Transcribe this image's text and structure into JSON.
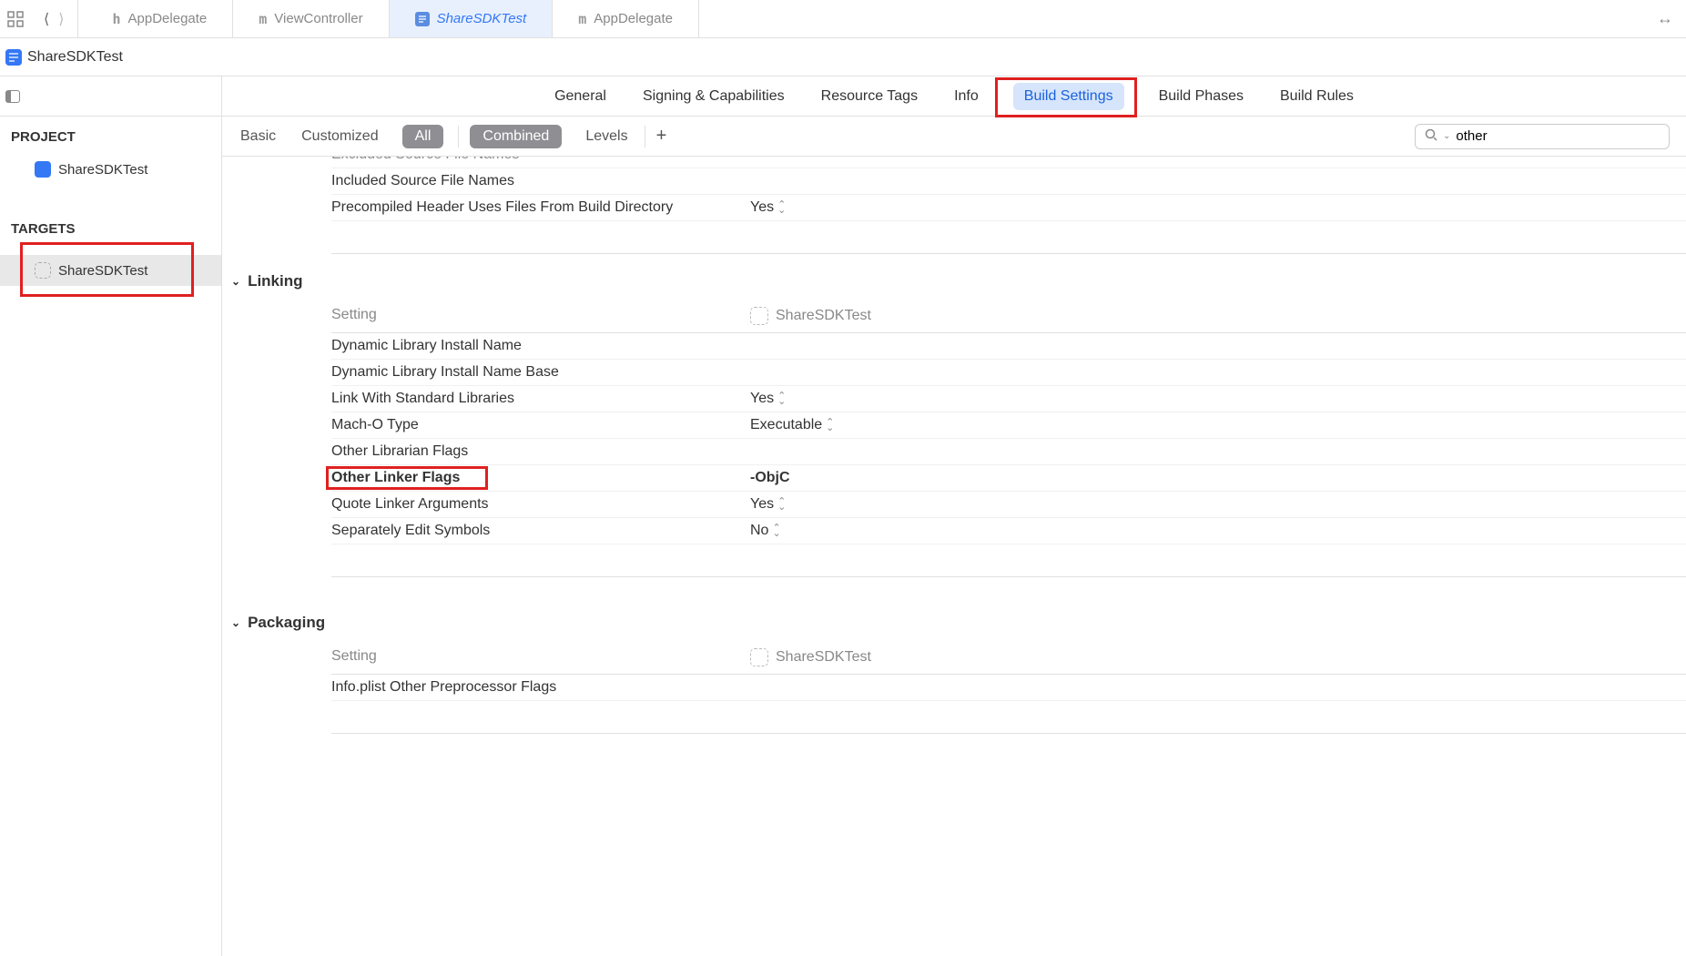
{
  "topTabs": [
    {
      "icon": "h",
      "label": "AppDelegate"
    },
    {
      "icon": "m",
      "label": "ViewController"
    },
    {
      "icon": "app",
      "label": "ShareSDKTest",
      "active": true
    },
    {
      "icon": "m",
      "label": "AppDelegate"
    }
  ],
  "breadcrumb": {
    "title": "ShareSDKTest"
  },
  "sidebar": {
    "projectHeader": "PROJECT",
    "projectName": "ShareSDKTest",
    "targetsHeader": "TARGETS",
    "targetName": "ShareSDKTest"
  },
  "tabNav": [
    {
      "label": "General"
    },
    {
      "label": "Signing & Capabilities"
    },
    {
      "label": "Resource Tags"
    },
    {
      "label": "Info"
    },
    {
      "label": "Build Settings",
      "active": true,
      "highlighted": true
    },
    {
      "label": "Build Phases"
    },
    {
      "label": "Build Rules"
    }
  ],
  "filterBar": {
    "basic": "Basic",
    "customized": "Customized",
    "all": "All",
    "combined": "Combined",
    "levels": "Levels"
  },
  "search": {
    "value": "other"
  },
  "sections": {
    "precompiled": {
      "rows": [
        {
          "name": "Excluded Source File Names",
          "value": "",
          "cutoff": true
        },
        {
          "name": "Included Source File Names",
          "value": ""
        },
        {
          "name": "Precompiled Header Uses Files From Build Directory",
          "value": "Yes",
          "dropdown": true
        }
      ]
    },
    "linking": {
      "title": "Linking",
      "settingLabel": "Setting",
      "targetName": "ShareSDKTest",
      "rows": [
        {
          "name": "Dynamic Library Install Name",
          "value": ""
        },
        {
          "name": "Dynamic Library Install Name Base",
          "value": ""
        },
        {
          "name": "Link With Standard Libraries",
          "value": "Yes",
          "dropdown": true
        },
        {
          "name": "Mach-O Type",
          "value": "Executable",
          "dropdown": true
        },
        {
          "name": "Other Librarian Flags",
          "value": ""
        },
        {
          "name": "Other Linker Flags",
          "value": "-ObjC",
          "bold": true,
          "highlighted": true
        },
        {
          "name": "Quote Linker Arguments",
          "value": "Yes",
          "dropdown": true
        },
        {
          "name": "Separately Edit Symbols",
          "value": "No",
          "dropdown": true
        }
      ]
    },
    "packaging": {
      "title": "Packaging",
      "settingLabel": "Setting",
      "targetName": "ShareSDKTest",
      "rows": [
        {
          "name": "Info.plist Other Preprocessor Flags",
          "value": ""
        }
      ]
    }
  }
}
